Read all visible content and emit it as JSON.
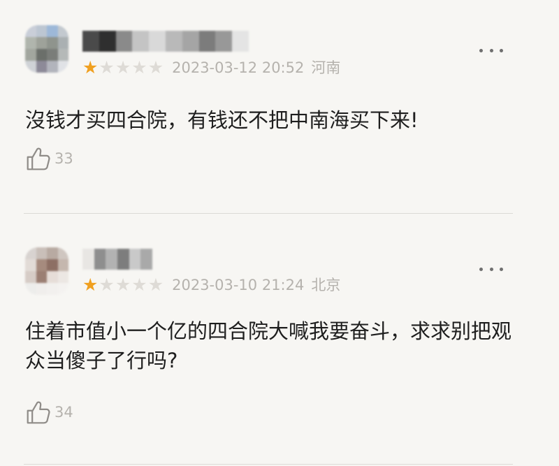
{
  "reviews": [
    {
      "rating": 1,
      "max_rating": 5,
      "timestamp": "2023-03-12 20:52",
      "location": "河南",
      "content": "沒钱才买四合院，有钱还不把中南海买下来!",
      "likes": "33",
      "avatar_colors": [
        "#c9ced8",
        "#bcc6d2",
        "#9db8d8",
        "#c3c9cf",
        "#b0b5ad",
        "#9ea29a",
        "#8f948d",
        "#aab0b2",
        "#a2a69e",
        "#6b6f6a",
        "#7a7d79",
        "#b5b9b8",
        "#cfd2d6",
        "#8d8a98",
        "#b2b4bc",
        "#e0e2e6"
      ],
      "username_colors": [
        "#4a4a4a",
        "#2f2f2f",
        "#8a8a8a",
        "#c4c4c4",
        "#d9d9d9",
        "#b9b9b9",
        "#a5a5a5",
        "#7c7c7c",
        "#989898",
        "#e4e4e4"
      ]
    },
    {
      "rating": 1,
      "max_rating": 5,
      "timestamp": "2023-03-10 21:24",
      "location": "北京",
      "content": "住着市值小一个亿的四合院大喊我要奋斗，求求别把观众当傻子了行吗?",
      "likes": "34",
      "avatar_colors": [
        "#d8d3d0",
        "#c9bfb9",
        "#b8aaa2",
        "#cfc6c0",
        "#e2dbd6",
        "#a68b7e",
        "#8d6f64",
        "#c5b7ae",
        "#d6ccc6",
        "#9b7f73",
        "#e6ddd8",
        "#ece7e3",
        "#ededeb",
        "#f0eeec",
        "#f2f0ee",
        "#f4f2f0"
      ],
      "username_colors": [
        "#e8e6e3",
        "#8e8e8e",
        "#b2b2b2",
        "#7d7d7d",
        "#c9c9c9",
        "#a9a9a9"
      ]
    }
  ],
  "colors": {
    "background": "#f7f6f3",
    "star_active": "#f0a020",
    "star_inactive": "#dedbd6",
    "meta_text": "#b5b2ad",
    "content_text": "#1e1e1e"
  },
  "icons": {
    "more": "more-dots-icon",
    "like": "thumbs-up-icon",
    "star": "star-icon"
  }
}
